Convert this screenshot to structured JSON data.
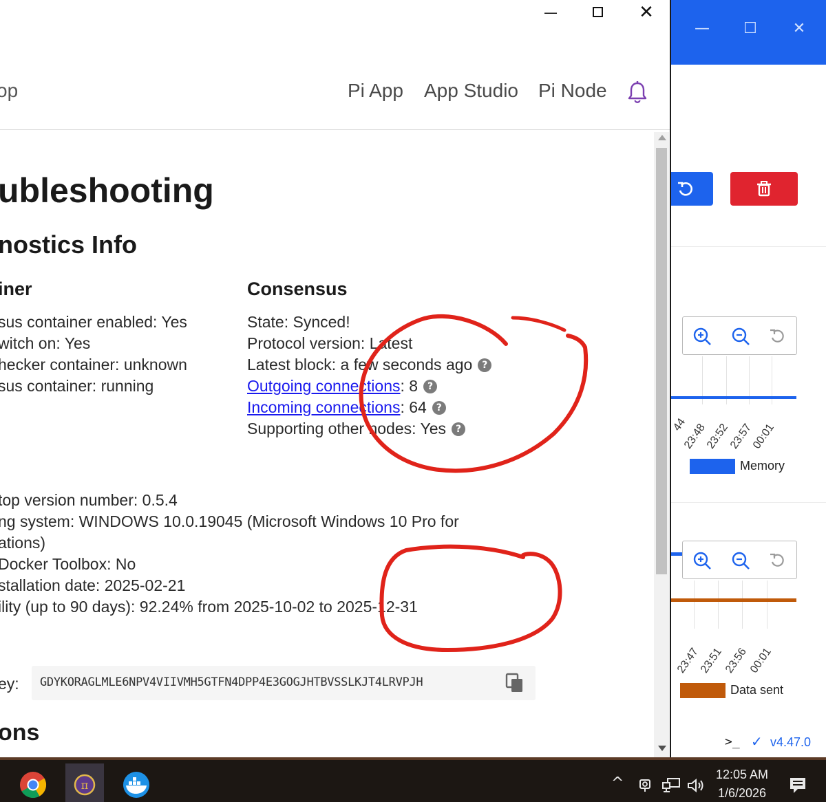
{
  "left_window": {
    "controls": {
      "minimize": "—",
      "close": "✕"
    },
    "header": {
      "brand_fragment": "op",
      "nav": [
        "Pi App",
        "App Studio",
        "Pi Node"
      ],
      "bell_icon": "bell-icon"
    },
    "page_title": "ubleshooting",
    "diagnostics_title": "nostics Info",
    "container": {
      "heading": "iner",
      "rows": [
        "sus container enabled: Yes",
        "witch on: Yes",
        "hecker container: unknown",
        "sus container: running"
      ]
    },
    "consensus": {
      "heading": "Consensus",
      "state": "State: Synced!",
      "protocol": "Protocol version: Latest",
      "latest_block": "Latest block: a few seconds ago",
      "outgoing_link": "Outgoing connections",
      "outgoing_value": ": 8",
      "incoming_link": "Incoming connections",
      "incoming_value": ": 64",
      "supporting": "Supporting other nodes: Yes",
      "help_glyph": "?"
    },
    "system": {
      "rows": [
        "top version number: 0.5.4",
        "ng system: WINDOWS 10.0.19045 (Microsoft Windows 10 Pro for",
        "ations)",
        "Docker Toolbox: No",
        "stallation date: 2025-02-21",
        "ility (up to 90 days): 92.24% from 2025-10-02 to 2025-12-31"
      ]
    },
    "key": {
      "label": "ey:",
      "value": "GDYKORAGLMLE6NPV4VIIVMH5GTFN4DPP4E3GOGJHTBVSSLKJT4LRVPJH",
      "copy_icon": "copy-icon"
    },
    "section_bottom": "ons"
  },
  "right_window": {
    "controls": {
      "minimize": "—",
      "maximize": "☐",
      "close": "✕"
    },
    "actions": {
      "restart_icon": "restart-icon",
      "delete_icon": "trash-icon"
    },
    "memory_chart": {
      "ticks": [
        "44",
        "23:48",
        "23:52",
        "23:57",
        "00:01"
      ],
      "legend": "Memory",
      "color": "#1d63ed"
    },
    "network_chart": {
      "ticks": [
        "47",
        "23:51",
        "23:56",
        "00:01"
      ],
      "tick_first": "23:47",
      "legend": "Data sent",
      "color": "#c05a0a"
    },
    "status": {
      "terminal": ">_",
      "check": "✓",
      "version": "v4.47.0"
    }
  },
  "taskbar": {
    "apps": [
      "chrome-icon",
      "pi-network-icon",
      "docker-icon"
    ],
    "tray": {
      "chevron": "^",
      "time": "12:05 AM",
      "date": "1/6/2026"
    }
  },
  "colors": {
    "annotation_red": "#e0231a",
    "docker_blue": "#1d63ed",
    "link_blue": "#1a1aee"
  }
}
